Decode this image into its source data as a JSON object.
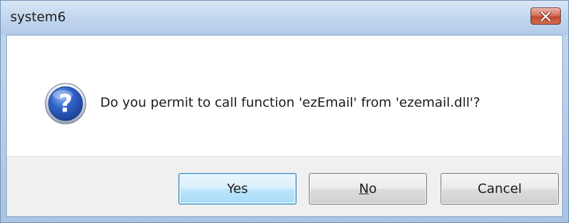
{
  "window": {
    "title": "system6"
  },
  "dialog": {
    "icon": "question-icon",
    "message": "Do you permit to call function 'ezEmail' from 'ezemail.dll'?"
  },
  "buttons": {
    "yes_label": "Yes",
    "no_mnemonic": "N",
    "no_rest": "o",
    "cancel_label": "Cancel"
  },
  "colors": {
    "close_button": "#c9533b",
    "default_button_border": "#3c7fb1",
    "question_icon": "#2656b8"
  }
}
